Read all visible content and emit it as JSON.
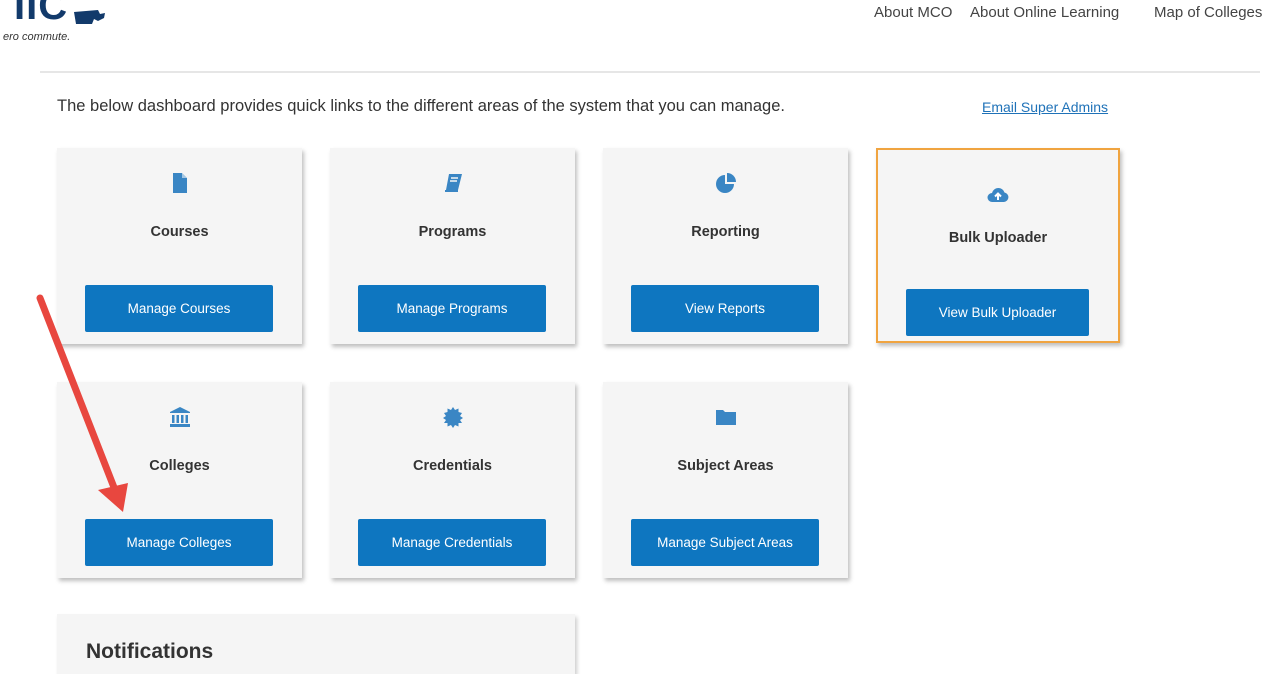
{
  "header": {
    "logo_mark": "IIC",
    "logo_tagline": "ero commute.",
    "nav": [
      "About MCO",
      "About Online Learning",
      "Map of Colleges"
    ]
  },
  "intro": "The below dashboard provides quick links to the different areas of the system that you can manage.",
  "email_link": "Email Super Admins",
  "cards": [
    {
      "label": "Courses",
      "button": "Manage Courses",
      "icon": "file-icon"
    },
    {
      "label": "Programs",
      "button": "Manage Programs",
      "icon": "book-icon"
    },
    {
      "label": "Reporting",
      "button": "View Reports",
      "icon": "pie-chart-icon"
    },
    {
      "label": "Bulk Uploader",
      "button": "View Bulk Uploader",
      "icon": "cloud-upload-icon",
      "highlighted": true
    },
    {
      "label": "Colleges",
      "button": "Manage Colleges",
      "icon": "institution-icon"
    },
    {
      "label": "Credentials",
      "button": "Manage Credentials",
      "icon": "certificate-icon"
    },
    {
      "label": "Subject Areas",
      "button": "Manage Subject Areas",
      "icon": "folder-icon"
    }
  ],
  "notifications": {
    "title": "Notifications"
  },
  "colors": {
    "accent": "#0e76c0",
    "highlight": "#f0a440",
    "arrow": "#e8473f",
    "icon": "#3a86c4"
  }
}
